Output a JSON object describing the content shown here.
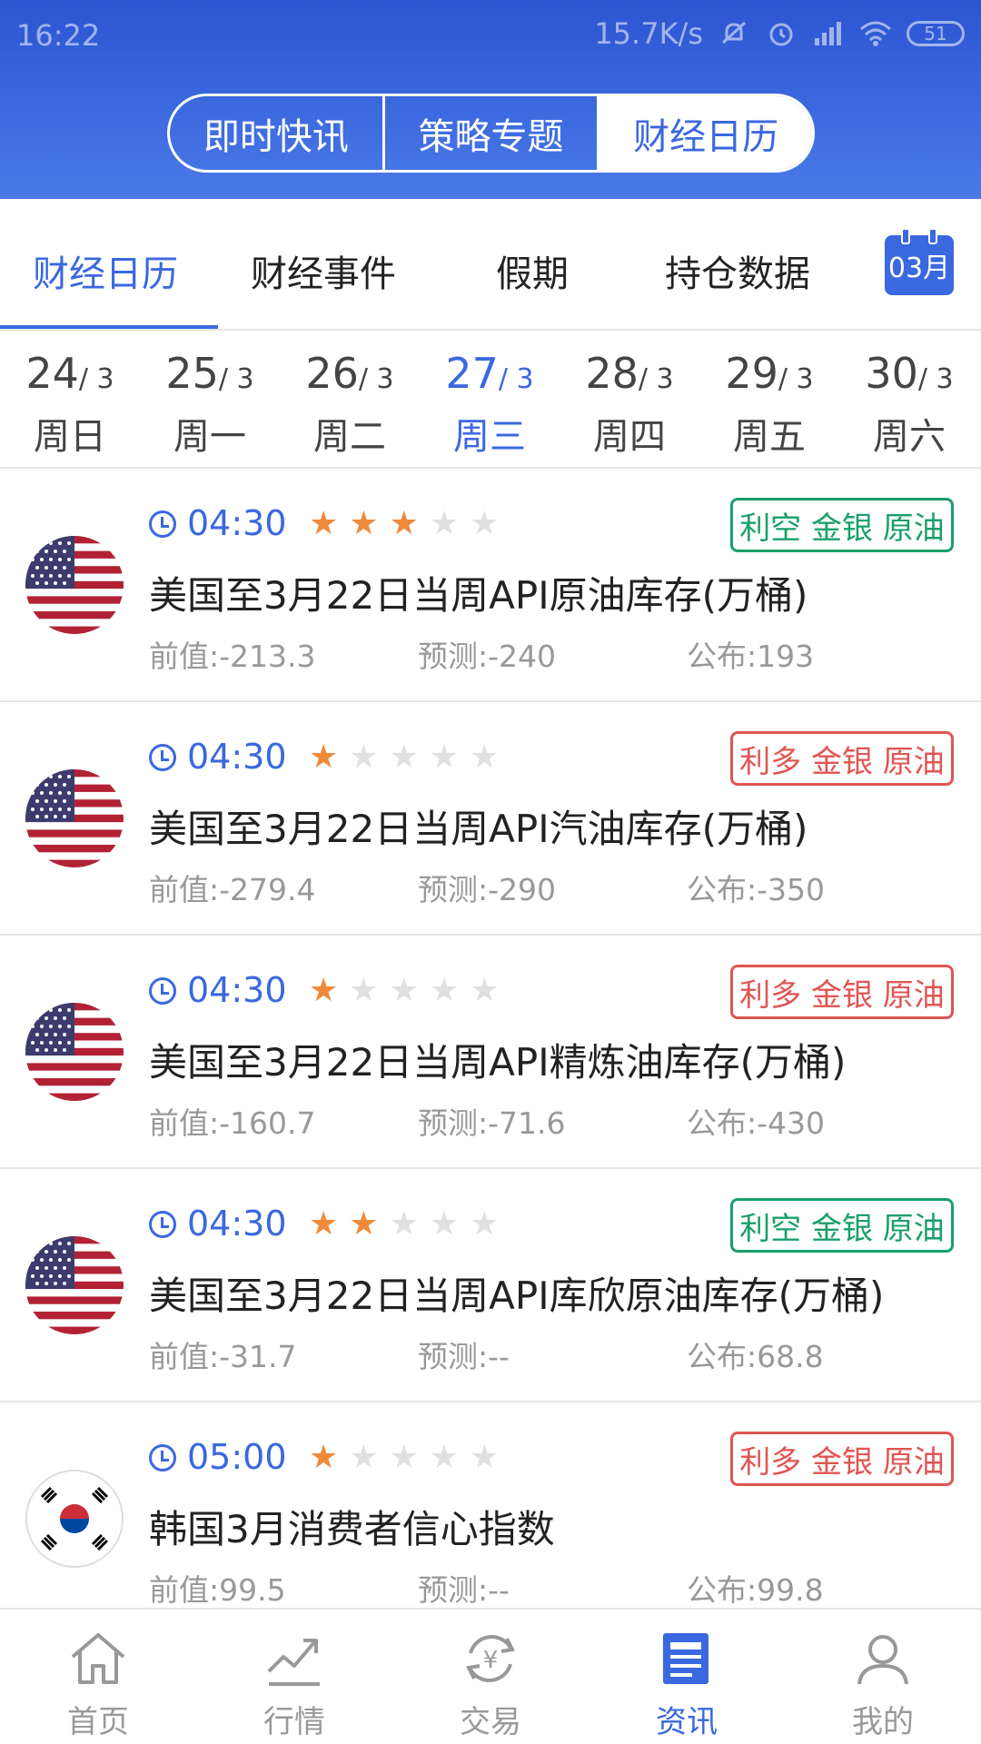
{
  "status": {
    "time": "16:22",
    "speed": "15.7K/s",
    "battery": "51"
  },
  "segments": [
    "即时快讯",
    "策略专题",
    "财经日历"
  ],
  "subtabs": [
    "财经日历",
    "财经事件",
    "假期",
    "持仓数据"
  ],
  "calendar_button": "03月",
  "dates": [
    {
      "day": "24",
      "month": "/ 3",
      "week": "周日"
    },
    {
      "day": "25",
      "month": "/ 3",
      "week": "周一"
    },
    {
      "day": "26",
      "month": "/ 3",
      "week": "周二"
    },
    {
      "day": "27",
      "month": "/ 3",
      "week": "周三"
    },
    {
      "day": "28",
      "month": "/ 3",
      "week": "周四"
    },
    {
      "day": "29",
      "month": "/ 3",
      "week": "周五"
    },
    {
      "day": "30",
      "month": "/ 3",
      "week": "周六"
    }
  ],
  "events": [
    {
      "time": "04:30",
      "stars": 3,
      "tag": "利空 金银 原油",
      "tag_color": "#18a06a",
      "title": "美国至3月22日当周API原油库存(万桶)",
      "prev": "前值:-213.3",
      "forecast": "预测:-240",
      "actual": "公布:193",
      "flag": "us-flag-icon"
    },
    {
      "time": "04:30",
      "stars": 1,
      "tag": "利多 金银 原油",
      "tag_color": "#e05552",
      "title": "美国至3月22日当周API汽油库存(万桶)",
      "prev": "前值:-279.4",
      "forecast": "预测:-290",
      "actual": "公布:-350",
      "flag": "us-flag-icon"
    },
    {
      "time": "04:30",
      "stars": 1,
      "tag": "利多 金银 原油",
      "tag_color": "#e05552",
      "title": "美国至3月22日当周API精炼油库存(万桶)",
      "prev": "前值:-160.7",
      "forecast": "预测:-71.6",
      "actual": "公布:-430",
      "flag": "us-flag-icon"
    },
    {
      "time": "04:30",
      "stars": 2,
      "tag": "利空 金银 原油",
      "tag_color": "#18a06a",
      "title": "美国至3月22日当周API库欣原油库存(万桶)",
      "prev": "前值:-31.7",
      "forecast": "预测:--",
      "actual": "公布:68.8",
      "flag": "us-flag-icon"
    },
    {
      "time": "05:00",
      "stars": 1,
      "tag": "利多 金银 原油",
      "tag_color": "#e05552",
      "title": "韩国3月消费者信心指数",
      "prev": "前值:99.5",
      "forecast": "预测:--",
      "actual": "公布:99.8",
      "flag": "kr-flag-icon"
    }
  ],
  "nav": [
    {
      "label": "首页",
      "icon": "home-icon"
    },
    {
      "label": "行情",
      "icon": "chart-icon"
    },
    {
      "label": "交易",
      "icon": "exchange-icon"
    },
    {
      "label": "资讯",
      "icon": "news-icon"
    },
    {
      "label": "我的",
      "icon": "user-icon"
    }
  ]
}
